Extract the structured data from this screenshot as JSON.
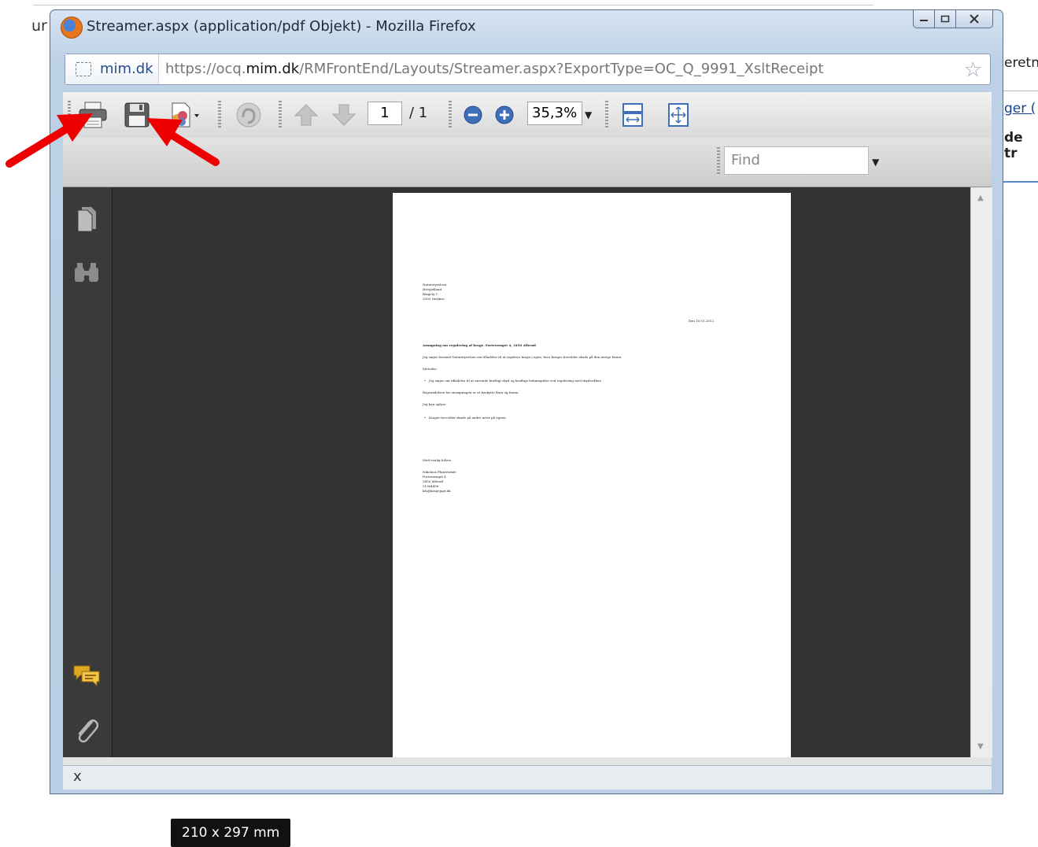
{
  "background": {
    "left_fragment": "ur",
    "right_fragment_1": "eretni",
    "right_fragment_2": "ger (",
    "right_fragment_3": "de tr"
  },
  "window": {
    "title": "Streamer.aspx (application/pdf Objekt) - Mozilla Firefox",
    "site_identity": "mim.dk",
    "url_prefix": "https://ocq.",
    "url_domain": "mim.dk",
    "url_path": "/RMFrontEnd/Layouts/Streamer.aspx?ExportType=OC_Q_9991_XsltReceipt"
  },
  "toolbar": {
    "page_current": "1",
    "page_total": "/ 1",
    "zoom": "35,3%",
    "find_placeholder": "Find"
  },
  "document": {
    "address_lines": [
      "Naturstyrelsen",
      "Østsjælland",
      "Ringvej 1",
      "3500 Værløse"
    ],
    "date": "Den 10.01.2012",
    "subject": "Ansøgning om regulering af krage. Fortevænget 4, 3450 Allerød",
    "intro": "Jeg søger hermed Naturstyrelsen om tilladelse til at regulere krage i egen, hvor krager forvolder skade på den øvrige fauna.",
    "method_heading": "Metoder:",
    "method_item": "Jeg søger om tilladelse til at anvende kraftigt skyd og kraftige bekæmpelse ved regulering med skydevåben",
    "reason": "Begrundelsen for ansøgningen er at beskytte flora og fauna.",
    "info_heading": "Jeg kan oplyse:",
    "info_item": "Krager forvolder skade på andre arter på egnen",
    "closing": "Med venlig hilsen",
    "signature_lines": [
      "Nikolaus Plantesdale",
      "Fortevænget 4",
      "3450 Allerød",
      "51964456",
      "kfs@kragejagt.dk"
    ]
  },
  "viewer": {
    "page_size": "210 x 297 mm"
  },
  "statusbar": {
    "close_label": "x"
  },
  "colors": {
    "annotation_arrow": "#ee0000",
    "viewer_bg": "#333333",
    "window_frame": "#bcd0e6"
  }
}
